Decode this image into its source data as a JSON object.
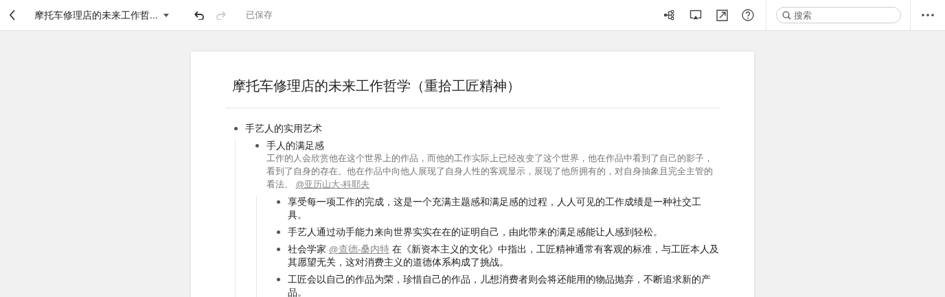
{
  "toolbar": {
    "doc_title": "摩托车修理店的未来工作哲...",
    "undo": {
      "disabled": false
    },
    "redo": {
      "disabled": true
    },
    "save_status": "已保存",
    "search": {
      "placeholder": "搜索"
    }
  },
  "document": {
    "title": "摩托车修理店的未来工作哲学（重拾工匠精神）",
    "outline": [
      {
        "parts": [
          {
            "kind": "text",
            "text": "手艺人的实用艺术"
          }
        ],
        "children": [
          {
            "parts": [
              {
                "kind": "text",
                "text": "手人的满足感"
              }
            ],
            "note": [
              {
                "kind": "text",
                "text": "工作的人会欣赏他在这个世界上的作品，而他的工作实际上已经改变了这个世界，他在作品中看到了自己的影子，看到了自身的存在。他在作品中向他人展现了自身人性的客观显示，展现了他所拥有的，对自身抽象且完全主管的看法。 "
              },
              {
                "kind": "mention",
                "text": "@亚历山大-科耶夫"
              }
            ],
            "children": [
              {
                "parts": [
                  {
                    "kind": "text",
                    "text": "享受每一项工作的完成，这是一个充满主题感和满足感的过程，人人可见的工作成绩是一种社交工具。"
                  }
                ]
              },
              {
                "parts": [
                  {
                    "kind": "text",
                    "text": "手艺人通过动手能力来向世界实实在在的证明自己，由此带来的满足感能让人感到轻松。"
                  }
                ]
              },
              {
                "parts": [
                  {
                    "kind": "text",
                    "text": "社会学家 "
                  },
                  {
                    "kind": "mention",
                    "text": "@查德-桑内特"
                  },
                  {
                    "kind": "text",
                    "text": " 在《新资本主义的文化》中指出，工匠精神通常有客观的标准，与工匠本人及其愿望无关，这对消费主义的道德体系构成了挑战。"
                  }
                ]
              },
              {
                "parts": [
                  {
                    "kind": "text",
                    "text": "工匠会以自己的作品为荣，珍惜自己的作品，儿想消费者则会将还能用的物品抛弃，不断追求新的产品。"
                  }
                ]
              }
            ]
          }
        ]
      }
    ]
  }
}
